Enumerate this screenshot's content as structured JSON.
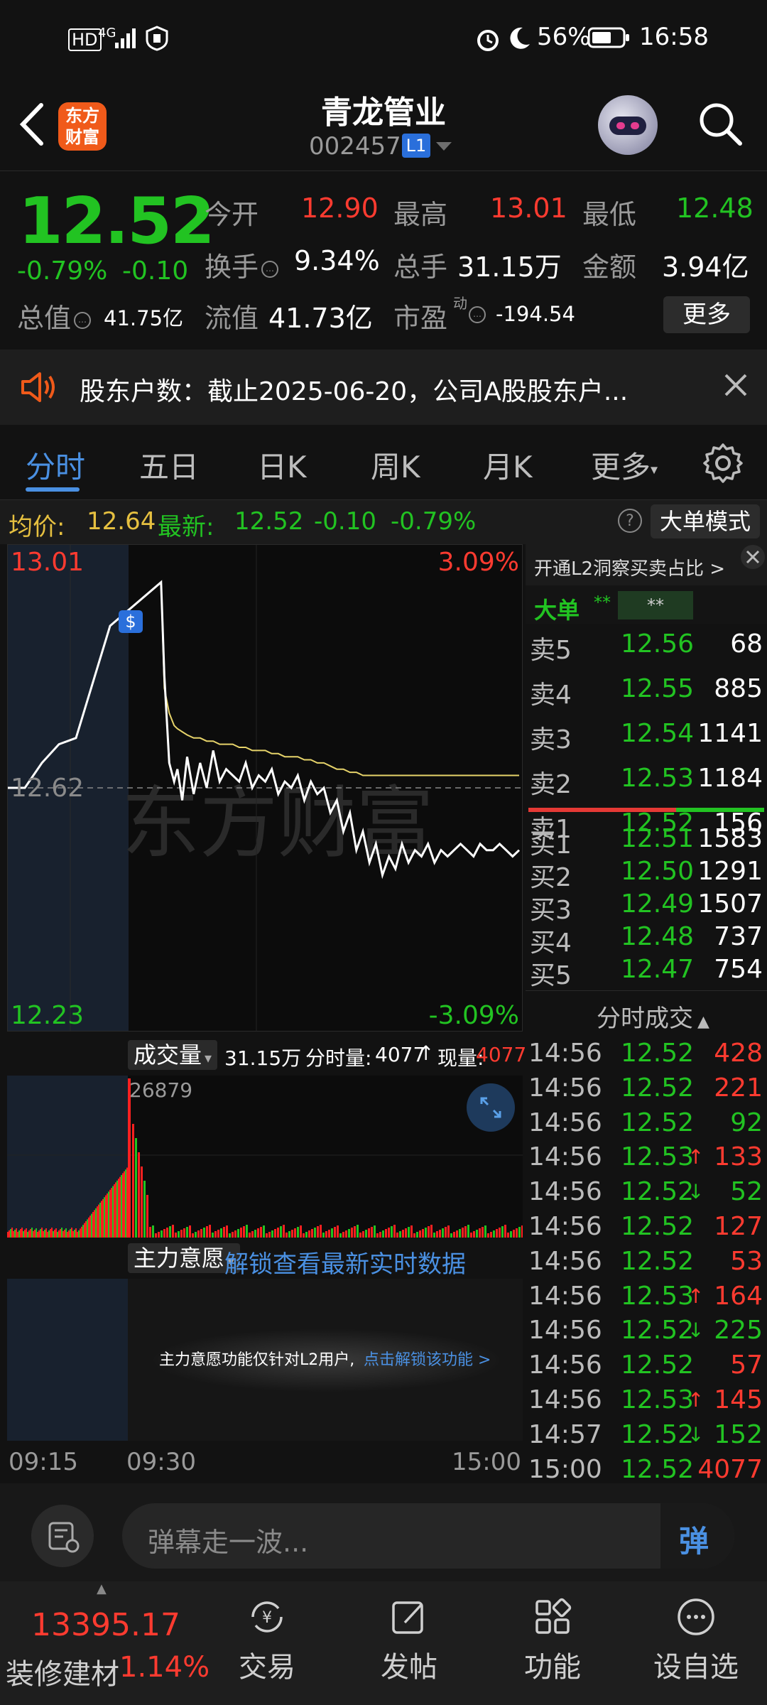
{
  "status_bar": {
    "hd": "HD",
    "signal": "4G",
    "battery_pct": "56%",
    "time": "16:58"
  },
  "header": {
    "logo_text": "东方财富",
    "title": "青龙管业",
    "code": "002457",
    "level_badge": "L1"
  },
  "quote": {
    "price": "12.52",
    "change_pct": "-0.79%",
    "change": "-0.10",
    "open_label": "今开",
    "open": "12.90",
    "high_label": "最高",
    "high": "13.01",
    "low_label": "最低",
    "low": "12.48",
    "turnover_label": "换手",
    "turnover": "9.34%",
    "volume_label": "总手",
    "volume": "31.15万",
    "amount_label": "金额",
    "amount": "3.94亿",
    "total_mv_label": "总值",
    "total_mv": "41.75亿",
    "float_mv_label": "流值",
    "float_mv": "41.73亿",
    "pe_label": "市盈",
    "pe_sup": "动",
    "pe": "-194.54",
    "more_label": "更多"
  },
  "notice": {
    "text": "股东户数：截止2025-06-20，公司A股股东户..."
  },
  "tabs": [
    {
      "label": "分时",
      "active": true
    },
    {
      "label": "五日"
    },
    {
      "label": "日K"
    },
    {
      "label": "周K"
    },
    {
      "label": "月K"
    },
    {
      "label": "更多"
    }
  ],
  "info_bar": {
    "avg_label": "均价:",
    "avg": "12.64",
    "latest_label": "最新:",
    "latest": "12.52",
    "chg": "-0.10",
    "chg_pct": "-0.79%",
    "mode_button": "大单模式"
  },
  "chart_labels": {
    "top_price": "13.01",
    "top_pct": "3.09%",
    "mid_price": "12.62",
    "bottom_price": "12.23",
    "bottom_pct": "-3.09%",
    "marker": "$",
    "watermark": "东方财富"
  },
  "chart_data": {
    "type": "line",
    "ylim": [
      12.23,
      13.01
    ],
    "x": [
      0,
      3,
      6,
      9,
      12,
      16,
      18,
      20,
      22,
      25,
      28,
      30,
      33,
      36,
      40,
      44,
      48,
      52,
      56,
      60,
      64,
      68,
      72,
      76,
      80,
      84,
      88,
      92,
      96,
      100,
      104,
      108,
      112,
      116,
      120,
      124,
      128,
      132,
      136,
      140,
      144,
      148,
      152,
      156,
      160,
      164,
      168,
      172,
      176,
      180,
      184,
      188,
      192,
      196,
      200,
      204,
      208,
      212,
      216,
      220,
      224,
      228,
      232,
      236,
      240
    ],
    "series": [
      {
        "values": [
          12.62,
          12.62,
          12.66,
          12.69,
          12.7,
          12.79,
          12.88,
          12.95,
          12.8,
          12.66,
          12.63,
          12.65,
          12.6,
          12.67,
          12.61,
          12.66,
          12.62,
          12.68,
          12.63,
          12.65,
          12.64,
          12.63,
          12.66,
          12.62,
          12.64,
          12.63,
          12.65,
          12.61,
          12.63,
          12.62,
          12.64,
          12.6,
          12.63,
          12.61,
          12.62,
          12.58,
          12.6,
          12.55,
          12.58,
          12.52,
          12.55,
          12.5,
          12.53,
          12.48,
          12.51,
          12.49,
          12.53,
          12.5,
          12.52,
          12.51,
          12.53,
          12.5,
          12.52,
          12.51,
          12.52,
          12.53,
          12.52,
          12.51,
          12.53,
          12.52,
          12.52,
          12.53,
          12.52,
          12.51,
          12.52
        ]
      },
      {
        "values": [
          null,
          null,
          null,
          null,
          null,
          null,
          null,
          12.95,
          12.78,
          12.74,
          12.72,
          12.715,
          12.71,
          12.705,
          12.7,
          12.7,
          12.695,
          12.695,
          12.69,
          12.69,
          12.69,
          12.685,
          12.685,
          12.68,
          12.68,
          12.68,
          12.675,
          12.675,
          12.67,
          12.67,
          12.67,
          12.665,
          12.665,
          12.66,
          12.66,
          12.655,
          12.65,
          12.65,
          12.645,
          12.645,
          12.64,
          12.64,
          12.64,
          12.64,
          12.64,
          12.64,
          12.64,
          12.64,
          12.64,
          12.64,
          12.64,
          12.64,
          12.64,
          12.64,
          12.64,
          12.64,
          12.64,
          12.64,
          12.64,
          12.64,
          12.64,
          12.64,
          12.64,
          12.64,
          12.64
        ]
      }
    ]
  },
  "volume": {
    "label": "成交量",
    "total": "31.15万",
    "minute_label": "分时量:",
    "minute": "4077",
    "now_label": "现量:",
    "now": "4077",
    "peak": "26879"
  },
  "mainforce": {
    "label": "主力意愿",
    "unlock": "解锁查看最新实时数据",
    "tip": "主力意愿功能仅针对L2用户,",
    "tip_link": "点击解锁该功能 >"
  },
  "time_axis": [
    "09:15",
    "09:30",
    "15:00"
  ],
  "order_book": {
    "banner": "开通L2洞察买卖占比 >",
    "big_label": "大单",
    "big_val": "**",
    "big_box": "**",
    "asks": [
      {
        "label": "卖5",
        "price": "12.56",
        "vol": "68"
      },
      {
        "label": "卖4",
        "price": "12.55",
        "vol": "885"
      },
      {
        "label": "卖3",
        "price": "12.54",
        "vol": "1141"
      },
      {
        "label": "卖2",
        "price": "12.53",
        "vol": "1184"
      },
      {
        "label": "卖1",
        "price": "12.52",
        "vol": "156"
      }
    ],
    "bids": [
      {
        "label": "买1",
        "price": "12.51",
        "vol": "1583"
      },
      {
        "label": "买2",
        "price": "12.50",
        "vol": "1291"
      },
      {
        "label": "买3",
        "price": "12.49",
        "vol": "1507"
      },
      {
        "label": "买4",
        "price": "12.48",
        "vol": "737"
      },
      {
        "label": "买5",
        "price": "12.47",
        "vol": "754"
      }
    ],
    "ticks_title": "分时成交",
    "ticks": [
      {
        "time": "14:56",
        "price": "12.52",
        "arrow": "",
        "vol": "428",
        "side": "red"
      },
      {
        "time": "14:56",
        "price": "12.52",
        "arrow": "",
        "vol": "221",
        "side": "red"
      },
      {
        "time": "14:56",
        "price": "12.52",
        "arrow": "",
        "vol": "92",
        "side": "green"
      },
      {
        "time": "14:56",
        "price": "12.53",
        "arrow": "↑",
        "vol": "133",
        "side": "red"
      },
      {
        "time": "14:56",
        "price": "12.52",
        "arrow": "↓",
        "vol": "52",
        "side": "green"
      },
      {
        "time": "14:56",
        "price": "12.52",
        "arrow": "",
        "vol": "127",
        "side": "red"
      },
      {
        "time": "14:56",
        "price": "12.52",
        "arrow": "",
        "vol": "53",
        "side": "red"
      },
      {
        "time": "14:56",
        "price": "12.53",
        "arrow": "↑",
        "vol": "164",
        "side": "red"
      },
      {
        "time": "14:56",
        "price": "12.52",
        "arrow": "↓",
        "vol": "225",
        "side": "green"
      },
      {
        "time": "14:56",
        "price": "12.52",
        "arrow": "",
        "vol": "57",
        "side": "red"
      },
      {
        "time": "14:56",
        "price": "12.53",
        "arrow": "↑",
        "vol": "145",
        "side": "red"
      },
      {
        "time": "14:57",
        "price": "12.52",
        "arrow": "↓",
        "vol": "152",
        "side": "green"
      },
      {
        "time": "15:00",
        "price": "12.52",
        "arrow": "",
        "vol": "4077",
        "side": "red"
      }
    ]
  },
  "danmu": {
    "placeholder": "弹幕走一波...",
    "button": "弹"
  },
  "nav": {
    "index_value": "13395.17",
    "index_name": "装修建材",
    "index_pct": "1.14%",
    "items": [
      {
        "label": "交易"
      },
      {
        "label": "发帖"
      },
      {
        "label": "功能"
      },
      {
        "label": "设自选"
      }
    ]
  },
  "colors": {
    "up": "#ff3b30",
    "down": "#22c322",
    "accent": "#4a90e2",
    "avg_line": "#e6d36a"
  }
}
